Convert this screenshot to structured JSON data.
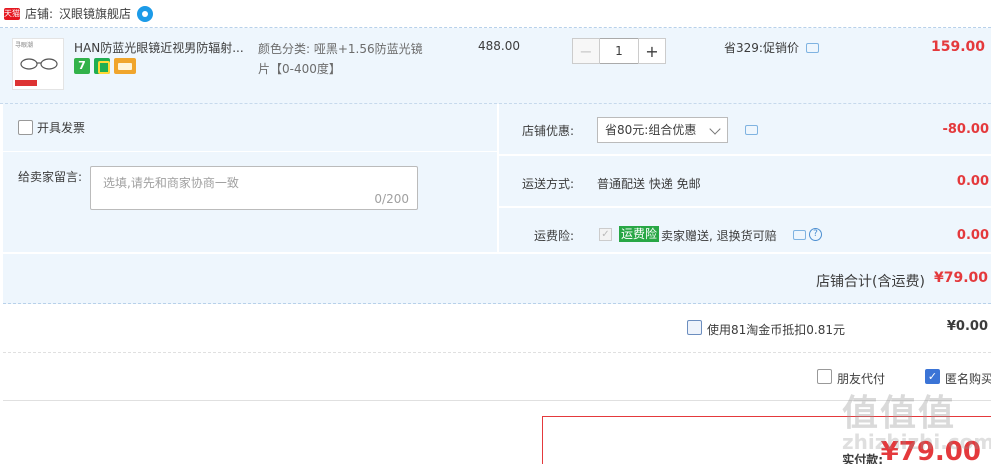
{
  "shop": {
    "badge": "天猫",
    "label": "店铺:",
    "name": "汉眼镜旗舰店"
  },
  "item": {
    "thumb_text": "寻眼潮",
    "title": "HAN防蓝光眼镜近视男防辐射...",
    "service_seven": "7",
    "sku_line1": "颜色分类: 哑黑+1.56防蓝光镜",
    "sku_line2": "片【0-400度】",
    "unit_price": "488.00",
    "quantity": "1",
    "qty_minus": "−",
    "qty_plus": "+",
    "promo": "省329:促销价",
    "subtotal": "159.00"
  },
  "options": {
    "invoice_label": "开具发票",
    "memo_label": "给卖家留言:",
    "memo_placeholder": "选填,请先和商家协商一致",
    "memo_count": "0/200",
    "discount_label": "店铺优惠:",
    "discount_select": "省80元:组合优惠",
    "discount_amount": "-80.00",
    "shipping_label": "运送方式:",
    "shipping_value": "普通配送 快递 免邮",
    "shipping_amount": "0.00",
    "insurance_label": "运费险:",
    "insurance_check": "✓",
    "insurance_badge": "运费险",
    "insurance_text": "卖家赠送, 退换货可赔",
    "insurance_help": "?",
    "insurance_amount": "0.00",
    "shop_total_label": "店铺合计(含运费)",
    "shop_total_amount": "¥79.00"
  },
  "coins": {
    "label": "使用81淘金币抵扣0.81元",
    "amount": "¥0.00"
  },
  "extras": {
    "friend_pay_label": "朋友代付",
    "anonymous_check": "✓",
    "anonymous_label": "匿名购买"
  },
  "payment": {
    "label": "实付款:",
    "amount": "¥79.00"
  },
  "watermark": {
    "main": "值值值",
    "sub": "zhizhizhi.com"
  }
}
